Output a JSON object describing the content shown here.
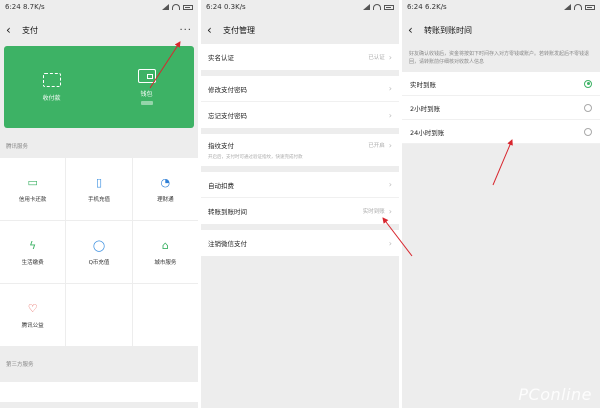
{
  "panel1": {
    "status": {
      "time": "6:24",
      "speed": "8.7K/s"
    },
    "nav": {
      "title": "支付",
      "more": "···"
    },
    "card": {
      "receive_label": "收付款",
      "wallet_label": "钱包"
    },
    "section1_title": "腾讯服务",
    "services": [
      {
        "label": "信用卡还款",
        "icon": "credit-card-icon",
        "color": "#3db265"
      },
      {
        "label": "手机充值",
        "icon": "phone-icon",
        "color": "#3a8fe0"
      },
      {
        "label": "理财通",
        "icon": "wealth-icon",
        "color": "#2f7fd6"
      },
      {
        "label": "生活缴费",
        "icon": "lightning-icon",
        "color": "#3db265"
      },
      {
        "label": "Q币充值",
        "icon": "qq-icon",
        "color": "#3a8fe0"
      },
      {
        "label": "城市服务",
        "icon": "city-icon",
        "color": "#3db265"
      },
      {
        "label": "腾讯公益",
        "icon": "heart-icon",
        "color": "#e0453a"
      }
    ],
    "section2_title": "第三方服务"
  },
  "panel2": {
    "status": {
      "time": "6:24",
      "speed": "0.3K/s"
    },
    "nav": {
      "title": "支付管理"
    },
    "rows": {
      "realname": {
        "label": "实名认证",
        "value": "已认证"
      },
      "change_pwd": {
        "label": "修改支付密码"
      },
      "forgot_pwd": {
        "label": "忘记支付密码"
      },
      "fingerprint": {
        "label": "指纹支付",
        "value": "已开启",
        "sub": "开启后，支付时可通过验证指纹，快速完成付款"
      },
      "auto_deduct": {
        "label": "自动扣费"
      },
      "transfer_time": {
        "label": "转账到账时间",
        "value": "实时到账"
      },
      "cancel": {
        "label": "注销微信支付"
      }
    }
  },
  "panel3": {
    "status": {
      "time": "6:24",
      "speed": "6.2K/s"
    },
    "nav": {
      "title": "转账到账时间"
    },
    "hint": "好友确认收钱后，资金将按如下时间存入对方零钱或账户。若转账发起后不零钱退回，请转账前仔细核对收款人信息",
    "options": [
      {
        "label": "实时到账",
        "selected": true
      },
      {
        "label": "2小时到账",
        "selected": false
      },
      {
        "label": "24小时到账",
        "selected": false
      }
    ]
  },
  "watermark": "PConline",
  "accent_color": "#3db265",
  "arrow_color": "#d8262e"
}
